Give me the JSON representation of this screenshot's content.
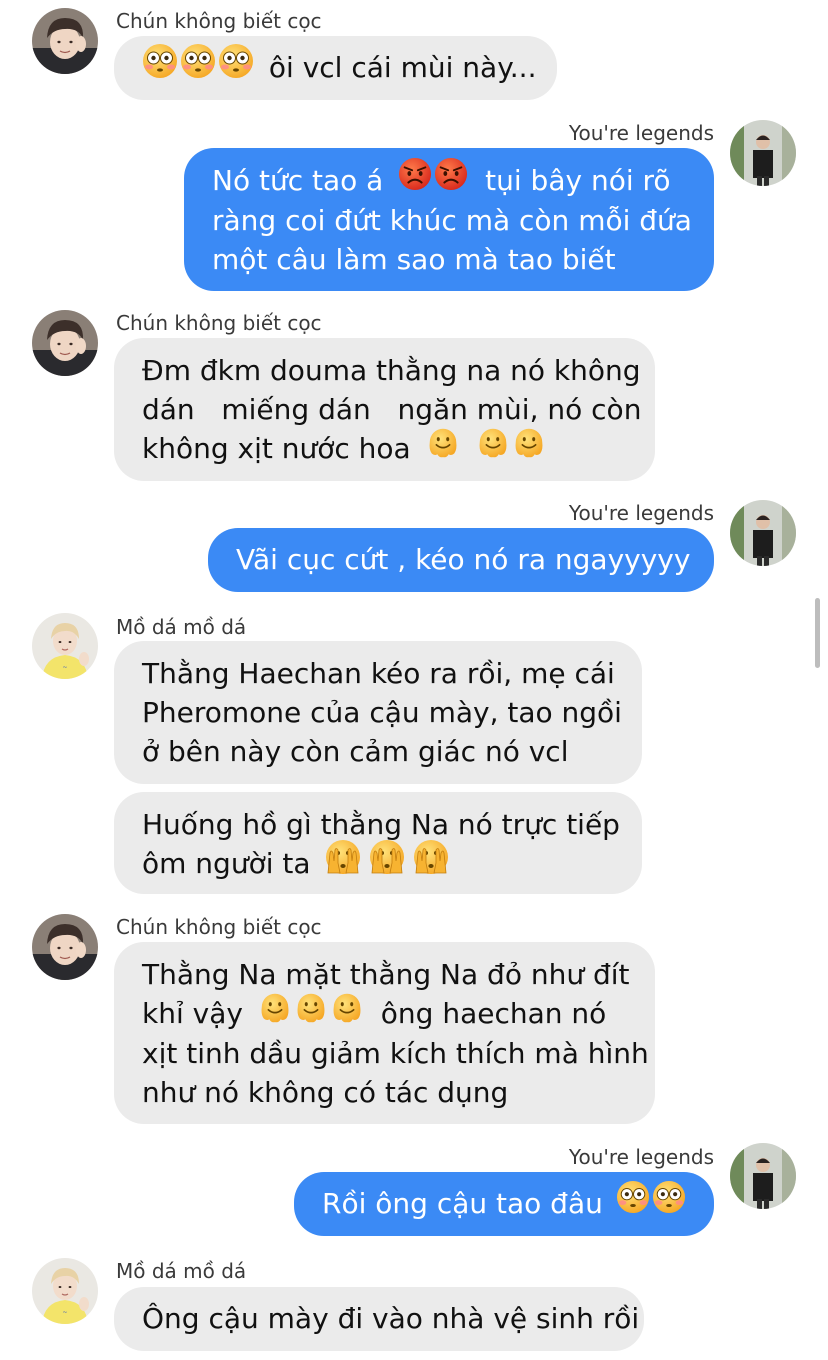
{
  "conversation": {
    "messages": [
      {
        "sender": "Chún không biết cọc",
        "lines": [
          "ôi vcl cái mùi này..."
        ]
      },
      {
        "sender": "You're legends",
        "lines": [
          "Nó tức tao á",
          "tụi bây nói rõ",
          "ràng coi đứt khúc mà còn mỗi đứa",
          "một câu làm sao mà tao biết"
        ]
      },
      {
        "sender": "Chún không biết cọc",
        "lines": [
          "Đm đkm douma thằng na nó không",
          "dán   miếng dán   ngăn mùi, nó còn",
          "không xịt nước hoa"
        ]
      },
      {
        "sender": "You're legends",
        "lines": [
          "Vãi cục cứt , kéo nó ra ngayyyyy"
        ]
      },
      {
        "sender": "Mồ dá mồ dá",
        "lines": [
          "Thằng Haechan kéo ra rồi, mẹ cái",
          "Pheromone của cậu mày, tao ngồi",
          "ở bên này còn cảm giác nó vcl"
        ]
      },
      {
        "sender": "",
        "lines": [
          "Huống hồ gì thằng Na nó trực tiếp",
          "ôm người ta"
        ]
      },
      {
        "sender": "Chún không biết cọc",
        "lines": [
          "Thằng Na mặt thằng Na đỏ như đít",
          "khỉ vậy",
          "ông haechan nó",
          "xịt tinh dầu giảm kích thích mà hình",
          "như nó không có tác dụng"
        ]
      },
      {
        "sender": "You're legends",
        "lines": [
          "Rồi ông cậu tao đâu"
        ]
      },
      {
        "sender": "Mồ dá mồ dá",
        "lines": [
          "Ông cậu mày đi vào nhà vệ sinh rồi"
        ]
      }
    ]
  },
  "emoji_names": {
    "flushed": "flushed-face",
    "angry": "angry-face",
    "melting": "melting-face",
    "peeking": "face-with-peeking-eye"
  },
  "colors": {
    "outgoing_bubble": "#3b8af5",
    "incoming_bubble": "#ebebeb",
    "sender_text": "#3a3a3a"
  }
}
